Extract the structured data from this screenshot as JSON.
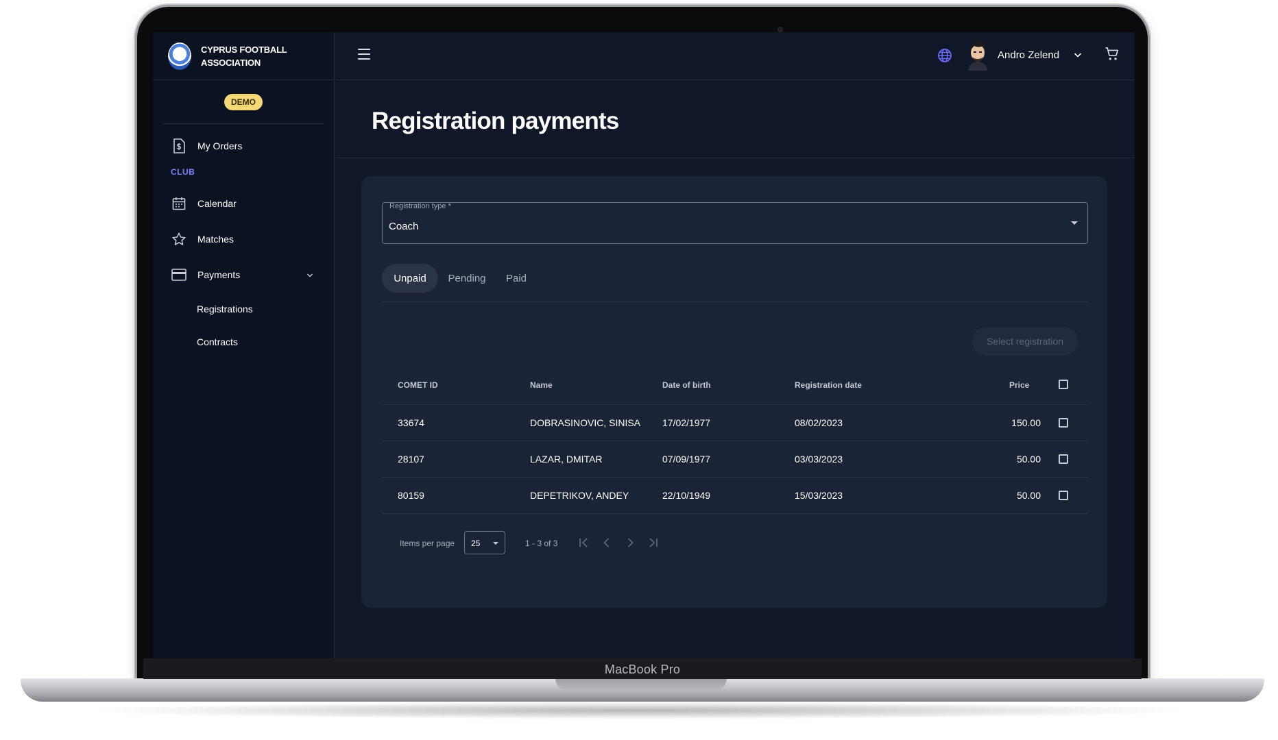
{
  "device": {
    "label": "MacBook Pro"
  },
  "brand": {
    "line1": "CYPRUS FOOTBALL",
    "line2": "ASSOCIATION",
    "badge": "DEMO"
  },
  "sidebar": {
    "items": [
      {
        "label": "My Orders",
        "icon": "invoice-icon"
      },
      {
        "label": "Calendar",
        "icon": "calendar-icon"
      },
      {
        "label": "Matches",
        "icon": "star-icon"
      },
      {
        "label": "Payments",
        "icon": "credit-card-icon"
      }
    ],
    "section": "CLUB",
    "payments_sub": [
      "Registrations",
      "Contracts"
    ]
  },
  "topbar": {
    "user_name": "Andro Zelend"
  },
  "page": {
    "title": "Registration payments"
  },
  "registration_type": {
    "label": "Registration type *",
    "value": "Coach"
  },
  "tabs": [
    {
      "label": "Unpaid",
      "active": true
    },
    {
      "label": "Pending",
      "active": false
    },
    {
      "label": "Paid",
      "active": false
    }
  ],
  "actions": {
    "select_registration": "Select registration"
  },
  "table": {
    "columns": [
      "COMET ID",
      "Name",
      "Date of birth",
      "Registration date",
      "Price"
    ],
    "rows": [
      {
        "comet_id": "33674",
        "name": "DOBRASINOVIC, SINISA",
        "dob": "17/02/1977",
        "reg_date": "08/02/2023",
        "price": "150.00"
      },
      {
        "comet_id": "28107",
        "name": "LAZAR, DMITAR",
        "dob": "07/09/1977",
        "reg_date": "03/03/2023",
        "price": "50.00"
      },
      {
        "comet_id": "80159",
        "name": "DEPETRIKOV, ANDEY",
        "dob": "22/10/1949",
        "reg_date": "15/03/2023",
        "price": "50.00"
      }
    ]
  },
  "pagination": {
    "label": "Items per page",
    "per_page": "25",
    "range": "1 - 3 of 3"
  },
  "colors": {
    "accent": "#7b84ff",
    "badge": "#f5d977",
    "background": "#0f1729",
    "card": "#1b2437"
  }
}
